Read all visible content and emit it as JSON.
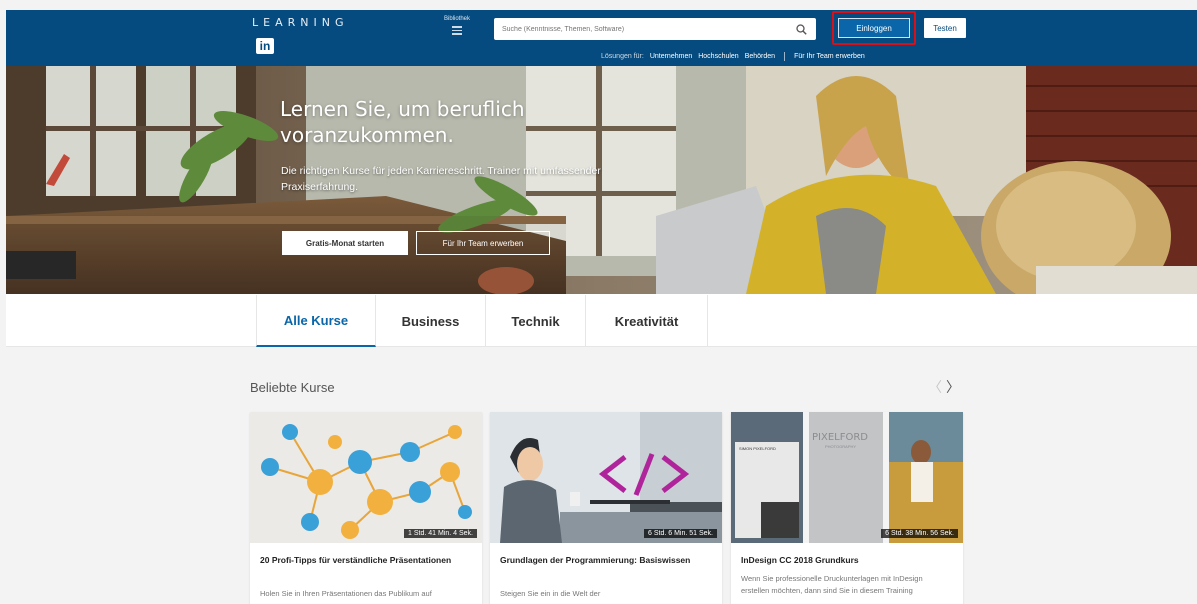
{
  "header": {
    "brand_word": "LEARNING",
    "brand_logo": "in",
    "library_label": "Bibliothek",
    "search_placeholder": "Suche (Kenntnisse, Themen, Software)",
    "login_label": "Einloggen",
    "try_label": "Testen",
    "solutions_label": "Lösungen für:",
    "solution_links": [
      "Unternehmen",
      "Hochschulen",
      "Behörden"
    ],
    "team_link": "Für Ihr Team erwerben",
    "colors": {
      "bar": "#054b7f",
      "highlight": "#d6111a"
    }
  },
  "hero": {
    "title": "Lernen Sie, um beruflich voranzukommen.",
    "subtitle": "Die richtigen Kurse für jeden Karriereschritt. Trainer mit umfassender Praxiserfahrung.",
    "primary_cta": "Gratis-Monat starten",
    "secondary_cta": "Für Ihr Team erwerben"
  },
  "tabs": [
    "Alle Kurse",
    "Business",
    "Technik",
    "Kreativität"
  ],
  "courses": {
    "section_title": "Beliebte Kurse",
    "prev_arrow": "〈",
    "next_arrow": "〉",
    "items": [
      {
        "title": "20 Profi-Tipps für verständliche Präsentationen",
        "description": "Holen Sie in Ihren Präsentationen das Publikum auf",
        "duration": "1 Std. 41 Min. 4 Sek."
      },
      {
        "title": "Grundlagen der Programmierung: Basiswissen",
        "description": "Steigen Sie ein in die Welt der",
        "duration": "6 Std. 6 Min. 51 Sek."
      },
      {
        "title": "InDesign CC 2018 Grundkurs",
        "description": "Wenn Sie professionelle Druckunterlagen mit InDesign erstellen möchten, dann sind Sie in diesem Training",
        "duration": "6 Std. 38 Min. 56 Sek.",
        "thumb_texts": {
          "left_name": "SIMON PIXELFORD",
          "brand": "PIXELFORD",
          "brand_sub": "PHOTOGRAPHY"
        }
      }
    ]
  }
}
